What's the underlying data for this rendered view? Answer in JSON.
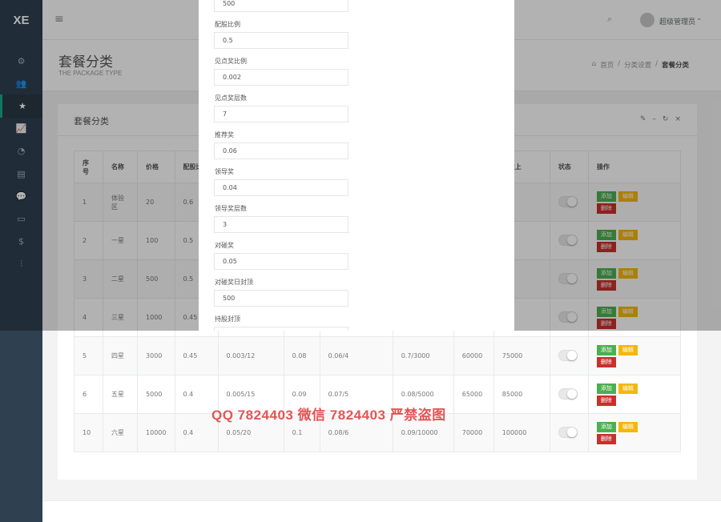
{
  "app": {
    "logo": "XE"
  },
  "sidebar": {
    "items": [
      {
        "icon": "cogs-icon",
        "glyph": "⚙",
        "active": false
      },
      {
        "icon": "users-icon",
        "glyph": "👥",
        "active": false
      },
      {
        "icon": "star-icon",
        "glyph": "★",
        "active": true
      },
      {
        "icon": "line-chart-icon",
        "glyph": "📈",
        "active": false
      },
      {
        "icon": "pie-chart-icon",
        "glyph": "◔",
        "active": false
      },
      {
        "icon": "list-icon",
        "glyph": "▤",
        "active": false
      },
      {
        "icon": "comments-icon",
        "glyph": "💬",
        "active": false
      },
      {
        "icon": "credit-card-icon",
        "glyph": "▭",
        "active": false
      },
      {
        "icon": "dollar-icon",
        "glyph": "$",
        "active": false
      },
      {
        "icon": "sliders-icon",
        "glyph": "⫶",
        "active": false
      }
    ]
  },
  "topbar": {
    "menu_glyph": "≡",
    "search_glyph": "⌕",
    "user_name": "超级管理员",
    "caret": "⌄"
  },
  "heading": {
    "title": "套餐分类",
    "subtitle": "THE PACKAGE TYPE",
    "breadcrumb": {
      "home": "首页",
      "sep": "/",
      "parent": "分类设置",
      "current": "套餐分类"
    }
  },
  "panel": {
    "title": "套餐分类",
    "tools": {
      "wrench": "✎",
      "minimize": "–",
      "refresh": "↻",
      "close": "×"
    }
  },
  "table": {
    "headers": [
      "序号",
      "名称",
      "价格",
      "配股比例",
      "",
      "",
      "",
      "",
      "",
      "收益上",
      "状态",
      "操作"
    ],
    "rows": [
      {
        "id": "1",
        "name": "体验区",
        "price": "20",
        "ratio": "0.6",
        "c5": "",
        "c6": "",
        "c7": "",
        "c8": "",
        "c9": "",
        "c10": "",
        "c11": ""
      },
      {
        "id": "2",
        "name": "一星",
        "price": "100",
        "ratio": "0.5",
        "c5": "",
        "c6": "",
        "c7": "",
        "c8": "",
        "c9": "",
        "c10": "",
        "c11": ""
      },
      {
        "id": "3",
        "name": "二星",
        "price": "500",
        "ratio": "0.5",
        "c5": "",
        "c6": "",
        "c7": "",
        "c8": "",
        "c9": "",
        "c10": "",
        "c11": "0"
      },
      {
        "id": "4",
        "name": "三星",
        "price": "1000",
        "ratio": "0.45",
        "c5": "",
        "c6": "",
        "c7": "",
        "c8": "",
        "c9": "",
        "c10": "",
        "c11": "0"
      },
      {
        "id": "5",
        "name": "四星",
        "price": "3000",
        "ratio": "0.45",
        "c5": "0.003/12",
        "c6": "0.08",
        "c7": "0.06/4",
        "c8": "0.7/3000",
        "c9": "60000",
        "c10": "75000",
        "c11": ""
      },
      {
        "id": "6",
        "name": "五星",
        "price": "5000",
        "ratio": "0.4",
        "c5": "0.005/15",
        "c6": "0.09",
        "c7": "0.07/5",
        "c8": "0.08/5000",
        "c9": "65000",
        "c10": "85000",
        "c11": ""
      },
      {
        "id": "10",
        "name": "六星",
        "price": "10000",
        "ratio": "0.4",
        "c5": "0.05/20",
        "c6": "0.1",
        "c7": "0.08/6",
        "c8": "0.09/10000",
        "c9": "70000",
        "c10": "100000",
        "c11": ""
      }
    ],
    "buttons": {
      "add": "添加",
      "edit": "编辑",
      "delete": "删除"
    }
  },
  "modal": {
    "top_value": "500",
    "fields": [
      {
        "label": "配股比例",
        "value": "0.5"
      },
      {
        "label": "见点奖比例",
        "value": "0.002"
      },
      {
        "label": "见点奖层数",
        "value": "7"
      },
      {
        "label": "推荐奖",
        "value": "0.06"
      },
      {
        "label": "领导奖",
        "value": "0.04"
      },
      {
        "label": "领导奖层数",
        "value": "3"
      },
      {
        "label": "对碰奖",
        "value": "0.05"
      },
      {
        "label": "对碰奖日封顶",
        "value": "500"
      },
      {
        "label": "持股封顶",
        "value": ""
      }
    ]
  },
  "watermark": "QQ 7824403  微信 7824403 严禁盗图",
  "colors": {
    "sidebar": "#2f4050",
    "add": "#4caf50",
    "edit": "#f5b70d",
    "delete": "#c9302c"
  }
}
